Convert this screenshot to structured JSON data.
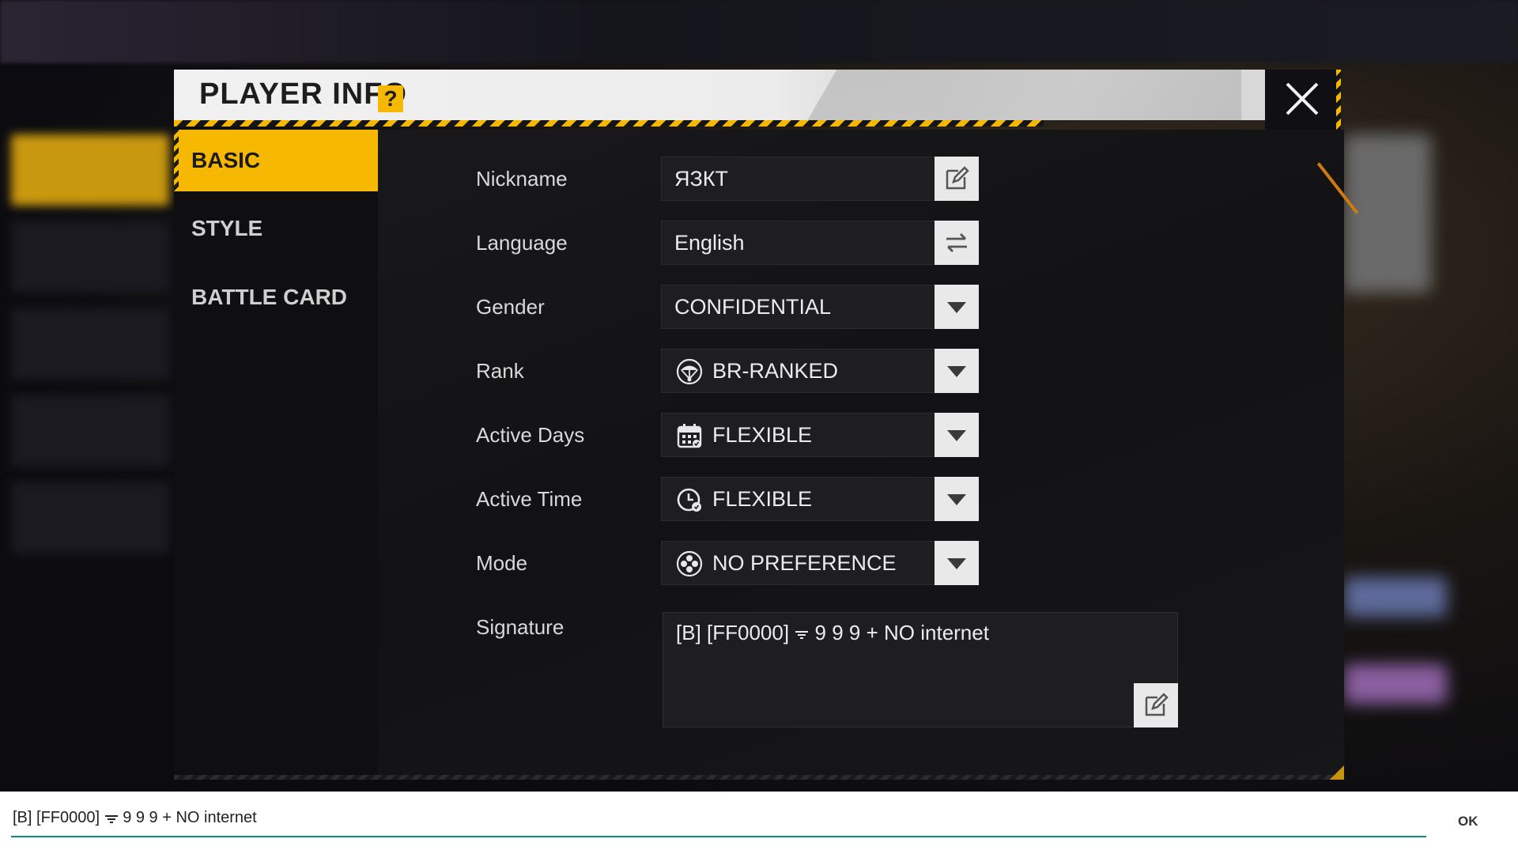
{
  "dialog": {
    "title": "PLAYER INFO",
    "help": "?"
  },
  "sidebar": {
    "items": [
      {
        "label": "BASIC",
        "active": true
      },
      {
        "label": "STYLE",
        "active": false
      },
      {
        "label": "BATTLE CARD",
        "active": false
      }
    ]
  },
  "form": {
    "nickname": {
      "label": "Nickname",
      "value": "ЯЗКТ",
      "icon": "edit-icon"
    },
    "language": {
      "label": "Language",
      "value": "English",
      "icon": "swap-icon"
    },
    "gender": {
      "label": "Gender",
      "value": "CONFIDENTIAL",
      "icon": "dropdown-icon"
    },
    "rank": {
      "label": "Rank",
      "value": "BR-RANKED",
      "icon": "parachute-icon"
    },
    "active_days": {
      "label": "Active Days",
      "value": "FLEXIBLE",
      "icon": "calendar-icon"
    },
    "active_time": {
      "label": "Active Time",
      "value": "FLEXIBLE",
      "icon": "clock-icon"
    },
    "mode": {
      "label": "Mode",
      "value": "NO PREFERENCE",
      "icon": "mode-icon"
    },
    "signature": {
      "label": "Signature",
      "value_a": "[B] [FF0000]",
      "value_b": "9 9 9 + NO internet",
      "icon": "edit-icon"
    }
  },
  "inputbar": {
    "text_a": "[B] [FF0000]",
    "text_b": "9 9 9 + NO internet",
    "ok_label": "OK"
  },
  "colors": {
    "accent": "#f6b800",
    "panel": "#121214",
    "ink": "#1d1d1d"
  }
}
